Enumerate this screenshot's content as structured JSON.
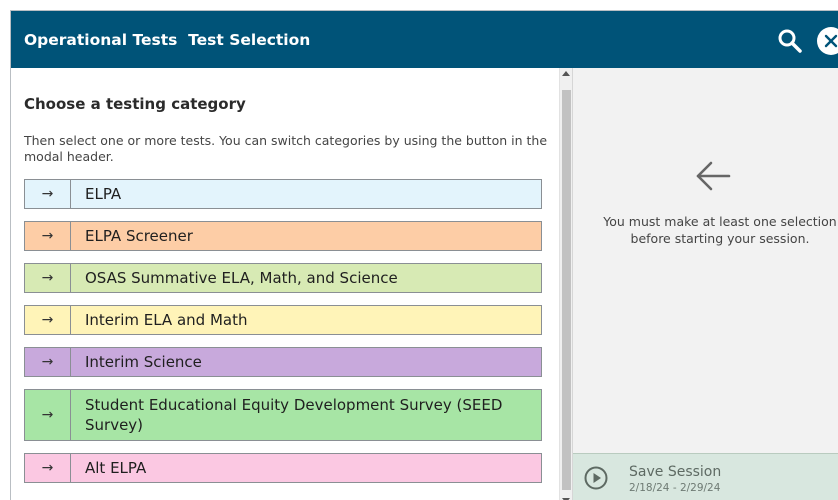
{
  "header": {
    "title": "Operational Tests  Test Selection",
    "search_icon": "search-icon",
    "close_icon": "close-icon",
    "bg_color": "#005378"
  },
  "main": {
    "heading": "Choose a testing category",
    "description": "Then select one or more tests. You can switch categories by using the button in the modal header.",
    "categories": [
      {
        "arrow": "→",
        "label": "ELPA",
        "color": "#e3f4fc"
      },
      {
        "arrow": "→",
        "label": "ELPA Screener",
        "color": "#fdcda6"
      },
      {
        "arrow": "→",
        "label": "OSAS Summative ELA, Math, and Science",
        "color": "#d7eab4"
      },
      {
        "arrow": "→",
        "label": "Interim ELA and Math",
        "color": "#fff4b8"
      },
      {
        "arrow": "→",
        "label": "Interim Science",
        "color": "#c8a9dc"
      },
      {
        "arrow": "→",
        "label": "Student Educational Equity Development Survey (SEED Survey)",
        "color": "#a7e5a5"
      },
      {
        "arrow": "→",
        "label": "Alt ELPA",
        "color": "#fbc8e2"
      }
    ]
  },
  "side": {
    "back_icon": "arrow-left-icon",
    "hint": "You must make at least one selection before starting your session.",
    "save_icon": "play-circle-icon",
    "save_label": "Save Session",
    "save_dates": "2/18/24 - 2/29/24"
  }
}
